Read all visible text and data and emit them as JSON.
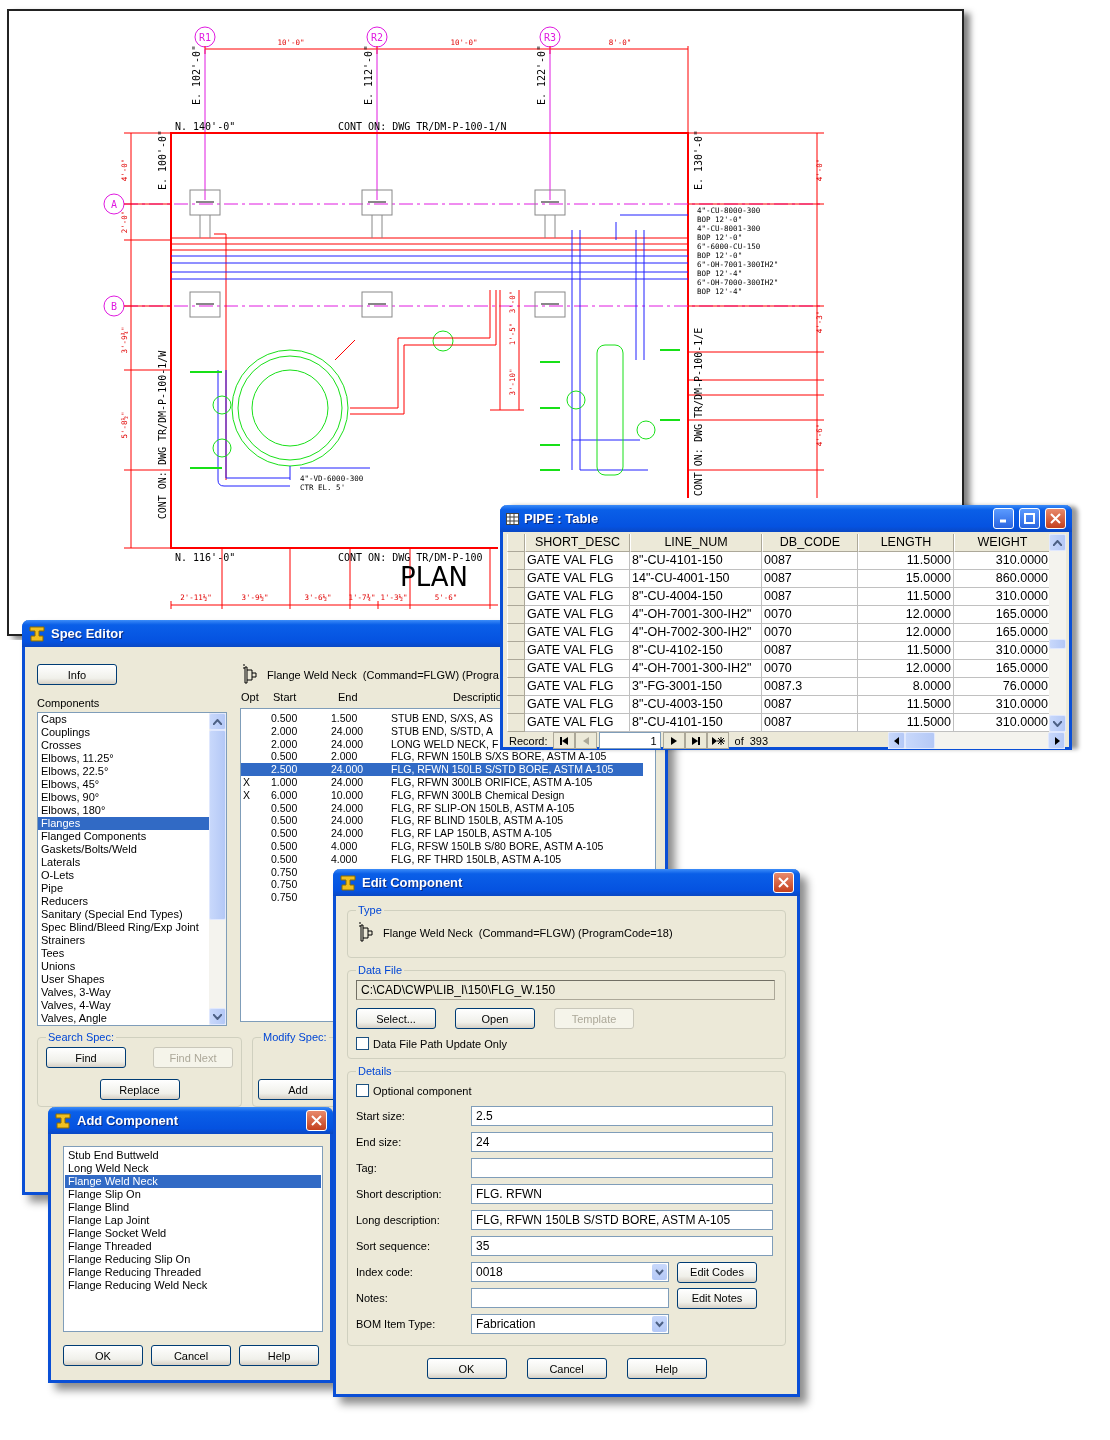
{
  "drawing": {
    "grid_bubbles": [
      "R1",
      "R2",
      "R3",
      "A",
      "B"
    ],
    "labels": [
      {
        "text": "E. 102'-0\"",
        "kind": "elevation"
      },
      {
        "text": "E. 112'-0\"",
        "kind": "elevation"
      },
      {
        "text": "E. 122'-0\"",
        "kind": "elevation"
      },
      {
        "text": "10'-0\"",
        "kind": "dimension"
      },
      {
        "text": "10'-0\"",
        "kind": "dimension"
      },
      {
        "text": "8'-0\"",
        "kind": "dimension"
      },
      {
        "text": "N. 140'-0\"",
        "kind": "elevation"
      },
      {
        "text": "CONT ON: DWG TR/DM-P-100-1/N",
        "kind": "elevation"
      },
      {
        "text": "E. 100'-0\"",
        "kind": "elevation"
      },
      {
        "text": "E. 130'-0\"",
        "kind": "elevation"
      },
      {
        "text": "4\"-CU-8000-300",
        "kind": "note"
      },
      {
        "text": "BOP 12'-0\"",
        "kind": "note"
      },
      {
        "text": "4\"-CU-8001-300",
        "kind": "note"
      },
      {
        "text": "BOP 12'-0\"",
        "kind": "note"
      },
      {
        "text": "6\"-6000-CU-150",
        "kind": "note"
      },
      {
        "text": "BOP 12'-0\"",
        "kind": "note"
      },
      {
        "text": "6\"-OH-7001-300IH2\"",
        "kind": "note"
      },
      {
        "text": "BOP 12'-4\"",
        "kind": "note"
      },
      {
        "text": "6\"-OH-7000-300IH2\"",
        "kind": "note"
      },
      {
        "text": "BOP 12'-4\"",
        "kind": "note"
      },
      {
        "text": "CONT ON: DWG TR/DM-P-100-1/W",
        "kind": "elevation"
      },
      {
        "text": "CONT ON: DWG TR/DM-P-100-1/E",
        "kind": "elevation"
      },
      {
        "text": "4\"-VD-6000-300",
        "kind": "note"
      },
      {
        "text": "CTR EL. 5'",
        "kind": "note"
      },
      {
        "text": "N. 116'-0\"",
        "kind": "elevation"
      },
      {
        "text": "CONT ON: DWG TR/DM-P-100",
        "kind": "elevation"
      },
      {
        "text": "PLAN",
        "kind": "title"
      },
      {
        "text": "2'-11½\"",
        "kind": "dimension"
      },
      {
        "text": "3'-9½\"",
        "kind": "dimension"
      },
      {
        "text": "3'-6½\"",
        "kind": "dimension"
      },
      {
        "text": "1'-7¾\"",
        "kind": "dimension"
      },
      {
        "text": "1'-3½\"",
        "kind": "dimension"
      },
      {
        "text": "5'-6\"",
        "kind": "dimension"
      },
      {
        "text": "4'-0\"",
        "kind": "dimension"
      },
      {
        "text": "2'-0\"",
        "kind": "dimension"
      },
      {
        "text": "3'-9¾\"",
        "kind": "dimension"
      },
      {
        "text": "5'-8½\"",
        "kind": "dimension"
      },
      {
        "text": "4'-0\"",
        "kind": "dimension"
      },
      {
        "text": "4'-3\"",
        "kind": "dimension"
      },
      {
        "text": "4'-6\"",
        "kind": "dimension"
      },
      {
        "text": "3'-0\"",
        "kind": "dimension"
      },
      {
        "text": "1'-5\"",
        "kind": "dimension"
      },
      {
        "text": "3'-10\"",
        "kind": "dimension"
      }
    ]
  },
  "pipe_table": {
    "title": "PIPE : Table",
    "columns": [
      "SHORT_DESC",
      "LINE_NUM",
      "DB_CODE",
      "LENGTH",
      "WEIGHT"
    ],
    "rows": [
      [
        "GATE VAL FLG",
        "8\"-CU-4101-150",
        "0087",
        "11.5000",
        "310.0000"
      ],
      [
        "GATE VAL FLG",
        "14\"-CU-4001-150",
        "0087",
        "15.0000",
        "860.0000"
      ],
      [
        "GATE VAL FLG",
        "8\"-CU-4004-150",
        "0087",
        "11.5000",
        "310.0000"
      ],
      [
        "GATE VAL FLG",
        "4\"-OH-7001-300-IH2\"",
        "0070",
        "12.0000",
        "165.0000"
      ],
      [
        "GATE VAL FLG",
        "4\"-OH-7002-300-IH2\"",
        "0070",
        "12.0000",
        "165.0000"
      ],
      [
        "GATE VAL FLG",
        "8\"-CU-4102-150",
        "0087",
        "11.5000",
        "310.0000"
      ],
      [
        "GATE VAL FLG",
        "4\"-OH-7001-300-IH2\"",
        "0070",
        "12.0000",
        "165.0000"
      ],
      [
        "GATE VAL FLG",
        "3\"-FG-3001-150",
        "0087.3",
        "8.0000",
        "76.0000"
      ],
      [
        "GATE VAL FLG",
        "8\"-CU-4003-150",
        "0087",
        "11.5000",
        "310.0000"
      ],
      [
        "GATE VAL FLG",
        "8\"-CU-4101-150",
        "0087",
        "11.5000",
        "310.0000"
      ]
    ],
    "record_label": "Record:",
    "record_value": "1",
    "record_of": "of",
    "record_count": "393"
  },
  "spec_editor": {
    "title": "Spec Editor",
    "info_button": "Info",
    "components_label": "Components",
    "components": [
      {
        "label": "Caps",
        "selected": false
      },
      {
        "label": "Couplings",
        "selected": false
      },
      {
        "label": "Crosses",
        "selected": false
      },
      {
        "label": "Elbows, 11.25°",
        "selected": false
      },
      {
        "label": "Elbows, 22.5°",
        "selected": false
      },
      {
        "label": "Elbows, 45°",
        "selected": false
      },
      {
        "label": "Elbows, 90°",
        "selected": false
      },
      {
        "label": "Elbows, 180°",
        "selected": false
      },
      {
        "label": "Flanges",
        "selected": true
      },
      {
        "label": "Flanged Components",
        "selected": false
      },
      {
        "label": "Gaskets/Bolts/Weld",
        "selected": false
      },
      {
        "label": "Laterals",
        "selected": false
      },
      {
        "label": "O-Lets",
        "selected": false
      },
      {
        "label": "Pipe",
        "selected": false
      },
      {
        "label": "Reducers",
        "selected": false
      },
      {
        "label": "Sanitary (Special End Types)",
        "selected": false
      },
      {
        "label": "Spec Blind/Bleed Ring/Exp Joint",
        "selected": false
      },
      {
        "label": "Strainers",
        "selected": false
      },
      {
        "label": "Tees",
        "selected": false
      },
      {
        "label": "Unions",
        "selected": false
      },
      {
        "label": "User Shapes",
        "selected": false
      },
      {
        "label": "Valves, 3-Way",
        "selected": false
      },
      {
        "label": "Valves, 4-Way",
        "selected": false
      },
      {
        "label": "Valves, Angle",
        "selected": false
      }
    ],
    "type_text": "Flange Weld Neck  (Command=FLGW) (Progra",
    "columns": [
      "Opt",
      "Start",
      "End",
      "Descriptio"
    ],
    "rows": [
      {
        "start": "0.500",
        "end": "1.500",
        "description": "STUB END, S/XS, AS",
        "selected": false
      },
      {
        "start": "2.000",
        "end": "24.000",
        "description": "STUB END, S/STD, A",
        "selected": false
      },
      {
        "start": "2.000",
        "end": "24.000",
        "description": "LONG WELD NECK, F",
        "selected": false
      },
      {
        "start": "0.500",
        "end": "2.000",
        "description": "FLG, RFWN 150LB S/XS BORE, ASTM A-105",
        "selected": false
      },
      {
        "start": "2.500",
        "end": "24.000",
        "description": "FLG, RFWN 150LB S/STD BORE, ASTM A-105",
        "selected": true
      },
      {
        "opt": "X",
        "start": "1.000",
        "end": "24.000",
        "description": "FLG, RFWN 300LB ORIFICE, ASTM A-105",
        "selected": false
      },
      {
        "opt": "X",
        "start": "6.000",
        "end": "10.000",
        "description": "FLG, RFWN 300LB Chemical Design",
        "selected": false
      },
      {
        "start": "0.500",
        "end": "24.000",
        "description": "FLG, RF SLIP-ON 150LB, ASTM A-105",
        "selected": false
      },
      {
        "start": "0.500",
        "end": "24.000",
        "description": "FLG, RF BLIND 150LB, ASTM A-105",
        "selected": false
      },
      {
        "start": "0.500",
        "end": "24.000",
        "description": "FLG, RF LAP 150LB, ASTM A-105",
        "selected": false
      },
      {
        "start": "0.500",
        "end": "4.000",
        "description": "FLG, RFSW 150LB S/80 BORE, ASTM A-105",
        "selected": false
      },
      {
        "start": "0.500",
        "end": "4.000",
        "description": "FLG, RF THRD 150LB, ASTM A-105",
        "selected": false
      },
      {
        "start": "0.750",
        "selected": false
      },
      {
        "start": "0.750",
        "selected": false
      },
      {
        "start": "0.750",
        "selected": false
      }
    ],
    "search_spec": {
      "title": "Search Spec:",
      "buttons": [
        {
          "label": "Find",
          "disabled": false
        },
        {
          "label": "Find Next",
          "disabled": true
        },
        {
          "label": "Replace",
          "disabled": false
        }
      ]
    },
    "modify_spec": {
      "title": "Modify Spec:",
      "buttons": [
        {
          "label": "Add",
          "disabled": false
        }
      ]
    }
  },
  "add_component": {
    "title": "Add Component",
    "items": [
      {
        "label": "Stub End Buttweld",
        "selected": false
      },
      {
        "label": "Long Weld Neck",
        "selected": false
      },
      {
        "label": "Flange Weld Neck",
        "selected": true
      },
      {
        "label": "Flange Slip On",
        "selected": false
      },
      {
        "label": "Flange Blind",
        "selected": false
      },
      {
        "label": "Flange Lap Joint",
        "selected": false
      },
      {
        "label": "Flange Socket Weld",
        "selected": false
      },
      {
        "label": "Flange Threaded",
        "selected": false
      },
      {
        "label": "Flange Reducing Slip On",
        "selected": false
      },
      {
        "label": "Flange Reducing Threaded",
        "selected": false
      },
      {
        "label": "Flange Reducing Weld Neck",
        "selected": false
      }
    ],
    "buttons": [
      "OK",
      "Cancel",
      "Help"
    ]
  },
  "edit_component": {
    "title": "Edit Component",
    "type_group": "Type",
    "type_text": "Flange Weld Neck  (Command=FLGW) (ProgramCode=18)",
    "data_file_group": "Data File",
    "data_file_path": "C:\\CAD\\CWP\\LIB_I\\150\\FLG_W.150",
    "file_buttons": [
      {
        "label": "Select...",
        "disabled": false
      },
      {
        "label": "Open",
        "disabled": false
      },
      {
        "label": "Template",
        "disabled": true
      }
    ],
    "path_update_only": {
      "label": "Data File Path Update Only",
      "checked": false
    },
    "details_group": "Details",
    "optional_component": {
      "label": "Optional component",
      "checked": false
    },
    "fields": [
      {
        "kind": "text",
        "label": "Start size:",
        "value": "2.5"
      },
      {
        "kind": "text",
        "label": "End size:",
        "value": "24"
      },
      {
        "kind": "text",
        "label": "Tag:"
      },
      {
        "kind": "text",
        "label": "Short description:",
        "value": "FLG. RFWN"
      },
      {
        "kind": "text",
        "label": "Long description:",
        "value": "FLG, RFWN 150LB S/STD BORE, ASTM A-105"
      },
      {
        "kind": "text",
        "label": "Sort sequence:",
        "value": "35"
      },
      {
        "kind": "select",
        "label": "Index code:",
        "value": "0018",
        "button": "Edit Codes"
      },
      {
        "kind": "short",
        "label": "Notes:",
        "button": "Edit Notes"
      },
      {
        "kind": "select",
        "label": "BOM Item Type:",
        "value": "Fabrication"
      }
    ],
    "buttons": [
      "OK",
      "Cancel",
      "Help"
    ]
  }
}
